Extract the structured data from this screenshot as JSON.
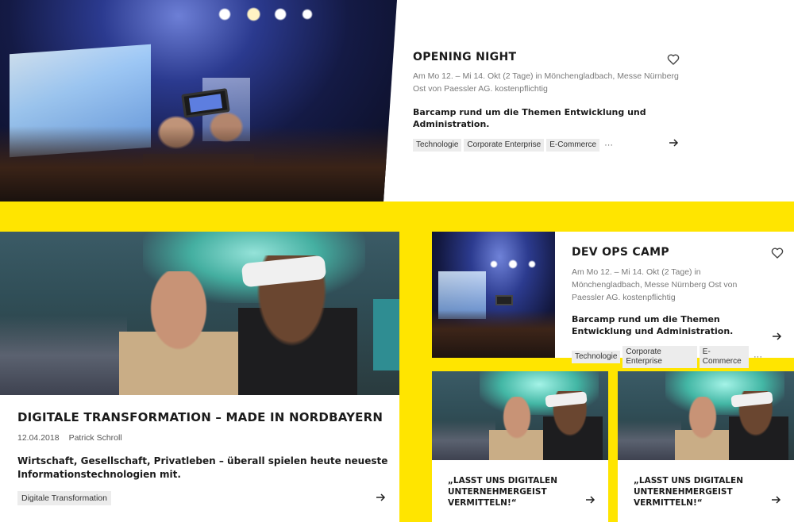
{
  "featured": {
    "title": "OPENING NIGHT",
    "meta": "Am Mo 12. – Mi 14. Okt (2 Tage) in Mönchengladbach, Messe Nürnberg Ost von Paessler AG. kostenpflichtig",
    "description": "Barcamp rund um die Themen Entwicklung und Administration.",
    "tags": [
      "Technologie",
      "Corporate Enterprise",
      "E-Commerce"
    ],
    "more_label": "···",
    "favorite_icon": "heart-icon",
    "link_icon": "arrow-right-icon"
  },
  "article": {
    "title": "DIGITALE TRANSFORMATION – MADE IN NORDBAYERN",
    "date": "12.04.2018",
    "author": "Patrick Schroll",
    "description": "Wirtschaft, Gesellschaft, Privatleben – überall spielen heute neueste Informationstechnologien mit.",
    "tag": "Digitale Transformation",
    "link_icon": "arrow-right-icon"
  },
  "event_card": {
    "title": "DEV OPS CAMP",
    "meta": "Am Mo 12. – Mi 14. Okt (2 Tage) in Mönchengladbach, Messe Nürnberg Ost von Paessler AG. kostenpflichtig",
    "description": "Barcamp rund um die Themen Entwicklung und Administration.",
    "tags": [
      "Technologie",
      "Corporate Enterprise",
      "E-Commerce"
    ],
    "more_label": "···",
    "favorite_icon": "heart-icon",
    "link_icon": "arrow-right-icon"
  },
  "quote_cards": [
    {
      "title": "„LASST UNS DIGITALEN UNTERNEHMERGEIST VERMITTELN!“",
      "link_icon": "arrow-right-icon"
    },
    {
      "title": "„LASST UNS DIGITALEN UNTERNEHMERGEIST VERMITTELN!“",
      "link_icon": "arrow-right-icon"
    }
  ],
  "colors": {
    "accent_yellow": "#ffe500",
    "card_bg": "#ffffff",
    "text": "#1b1b1b",
    "meta_gray": "#7a7a7a",
    "tag_bg": "#ececec"
  }
}
